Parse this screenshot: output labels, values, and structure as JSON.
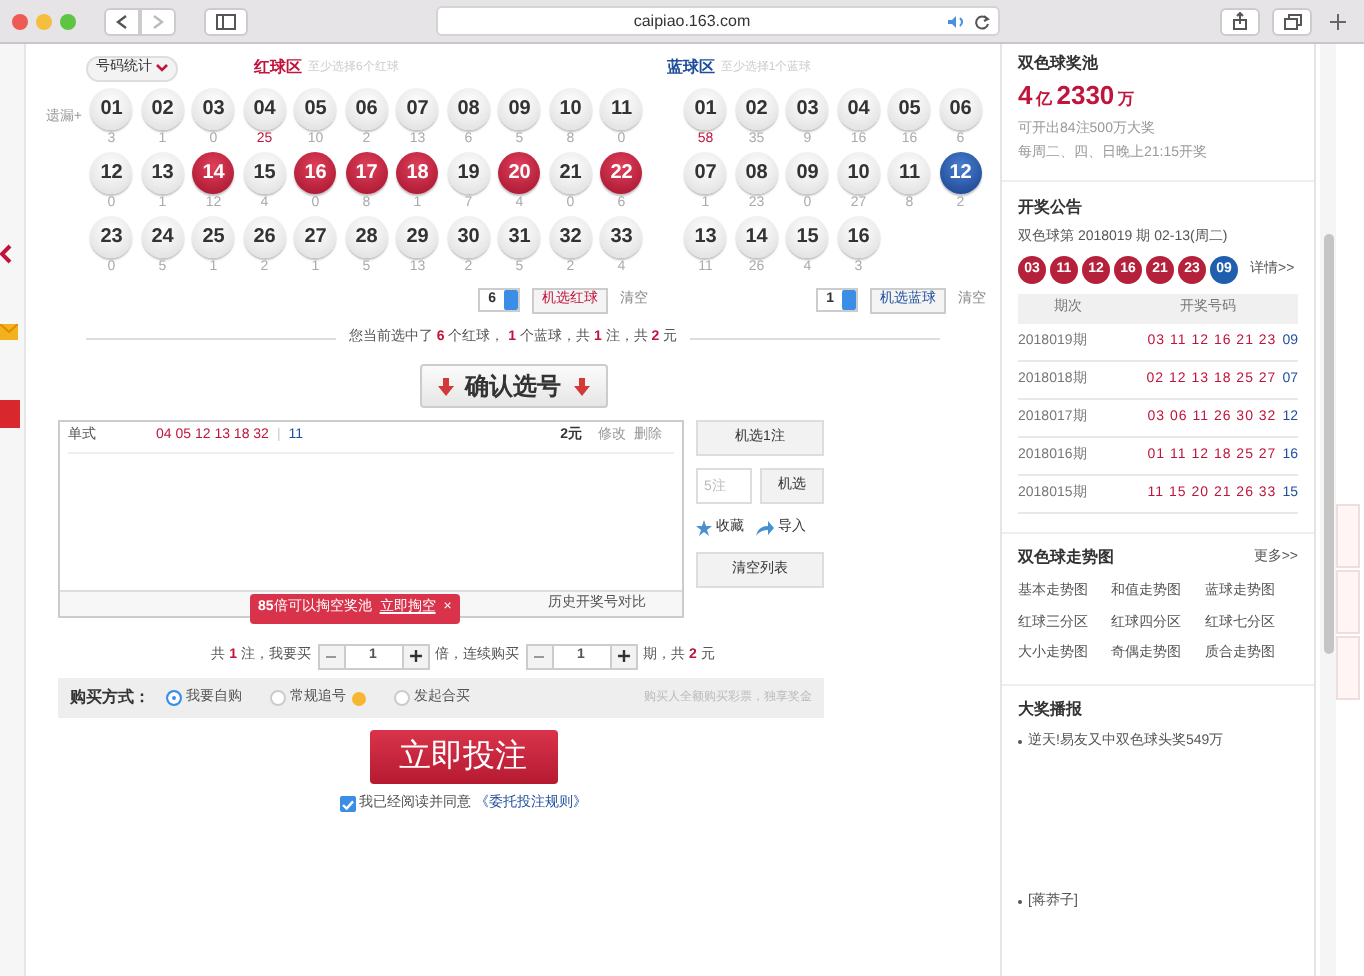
{
  "browser": {
    "url": "caipiao.163.com"
  },
  "stats_dropdown": "号码统计",
  "red_zone": {
    "title": "红球区",
    "hint": "至少选择6个红球",
    "miss_label": "遗漏+",
    "random_count": "6",
    "random_button": "机选红球",
    "clear": "清空",
    "balls": [
      {
        "number": "01",
        "miss": "3",
        "hot": false,
        "selected": false
      },
      {
        "number": "02",
        "miss": "1",
        "hot": false,
        "selected": false
      },
      {
        "number": "03",
        "miss": "0",
        "hot": false,
        "selected": false
      },
      {
        "number": "04",
        "miss": "25",
        "hot": true,
        "selected": false
      },
      {
        "number": "05",
        "miss": "10",
        "hot": false,
        "selected": false
      },
      {
        "number": "06",
        "miss": "2",
        "hot": false,
        "selected": false
      },
      {
        "number": "07",
        "miss": "13",
        "hot": false,
        "selected": false
      },
      {
        "number": "08",
        "miss": "6",
        "hot": false,
        "selected": false
      },
      {
        "number": "09",
        "miss": "5",
        "hot": false,
        "selected": false
      },
      {
        "number": "10",
        "miss": "8",
        "hot": false,
        "selected": false
      },
      {
        "number": "11",
        "miss": "0",
        "hot": false,
        "selected": false
      },
      {
        "number": "12",
        "miss": "0",
        "hot": false,
        "selected": false
      },
      {
        "number": "13",
        "miss": "1",
        "hot": false,
        "selected": false
      },
      {
        "number": "14",
        "miss": "12",
        "hot": false,
        "selected": true
      },
      {
        "number": "15",
        "miss": "4",
        "hot": false,
        "selected": false
      },
      {
        "number": "16",
        "miss": "0",
        "hot": false,
        "selected": true
      },
      {
        "number": "17",
        "miss": "8",
        "hot": false,
        "selected": true
      },
      {
        "number": "18",
        "miss": "1",
        "hot": false,
        "selected": true
      },
      {
        "number": "19",
        "miss": "7",
        "hot": false,
        "selected": false
      },
      {
        "number": "20",
        "miss": "4",
        "hot": false,
        "selected": true
      },
      {
        "number": "21",
        "miss": "0",
        "hot": false,
        "selected": false
      },
      {
        "number": "22",
        "miss": "6",
        "hot": false,
        "selected": true
      },
      {
        "number": "23",
        "miss": "0",
        "hot": false,
        "selected": false
      },
      {
        "number": "24",
        "miss": "5",
        "hot": false,
        "selected": false
      },
      {
        "number": "25",
        "miss": "1",
        "hot": false,
        "selected": false
      },
      {
        "number": "26",
        "miss": "2",
        "hot": false,
        "selected": false
      },
      {
        "number": "27",
        "miss": "1",
        "hot": false,
        "selected": false
      },
      {
        "number": "28",
        "miss": "5",
        "hot": false,
        "selected": false
      },
      {
        "number": "29",
        "miss": "13",
        "hot": false,
        "selected": false
      },
      {
        "number": "30",
        "miss": "2",
        "hot": false,
        "selected": false
      },
      {
        "number": "31",
        "miss": "5",
        "hot": false,
        "selected": false
      },
      {
        "number": "32",
        "miss": "2",
        "hot": false,
        "selected": false
      },
      {
        "number": "33",
        "miss": "4",
        "hot": false,
        "selected": false
      }
    ]
  },
  "blue_zone": {
    "title": "蓝球区",
    "hint": "至少选择1个蓝球",
    "random_count": "1",
    "random_button": "机选蓝球",
    "clear": "清空",
    "balls": [
      {
        "number": "01",
        "miss": "58",
        "hot": true,
        "selected": false
      },
      {
        "number": "02",
        "miss": "35",
        "hot": false,
        "selected": false
      },
      {
        "number": "03",
        "miss": "9",
        "hot": false,
        "selected": false
      },
      {
        "number": "04",
        "miss": "16",
        "hot": false,
        "selected": false
      },
      {
        "number": "05",
        "miss": "16",
        "hot": false,
        "selected": false
      },
      {
        "number": "06",
        "miss": "6",
        "hot": false,
        "selected": false
      },
      {
        "number": "07",
        "miss": "1",
        "hot": false,
        "selected": false
      },
      {
        "number": "08",
        "miss": "23",
        "hot": false,
        "selected": false
      },
      {
        "number": "09",
        "miss": "0",
        "hot": false,
        "selected": false
      },
      {
        "number": "10",
        "miss": "27",
        "hot": false,
        "selected": false
      },
      {
        "number": "11",
        "miss": "8",
        "hot": false,
        "selected": false
      },
      {
        "number": "12",
        "miss": "2",
        "hot": false,
        "selected": true
      },
      {
        "number": "13",
        "miss": "11",
        "hot": false,
        "selected": false
      },
      {
        "number": "14",
        "miss": "26",
        "hot": false,
        "selected": false
      },
      {
        "number": "15",
        "miss": "4",
        "hot": false,
        "selected": false
      },
      {
        "number": "16",
        "miss": "3",
        "hot": false,
        "selected": false
      }
    ]
  },
  "summary": "您当前选中了 **6** 个红球， **1** 个蓝球，共 **1** 注，共 **2** 元",
  "confirm_button": "确认选号",
  "ticket": {
    "type": "单式",
    "red": "04 05 12 13 18 32",
    "separator": "|",
    "blue": "11",
    "price": "2元",
    "edit": "修改",
    "delete": "删除"
  },
  "tooltip": {
    "text": "**85**倍可以掏空奖池",
    "link": "立即掏空",
    "close": "×"
  },
  "history_link": "历史开奖号对比",
  "side_buttons": {
    "random_one": "机选1注",
    "count_placeholder": "5注",
    "random": "机选",
    "favorite": "收藏",
    "import": "导入",
    "clear_list": "清空列表"
  },
  "quantity": {
    "lead": "共 **1** 注，我要买",
    "multiple": "1",
    "mid": "倍，连续购买",
    "periods": "1",
    "tail": "期，共 **2** 元"
  },
  "purchase": {
    "label": "购买方式：",
    "note": "购买人全额购买彩票，独享奖金",
    "options": [
      {
        "label": "我要自购",
        "selected": true,
        "help": false
      },
      {
        "label": "常规追号",
        "selected": false,
        "help": true
      },
      {
        "label": "发起合买",
        "selected": false,
        "help": false
      }
    ]
  },
  "bet_button": "立即投注",
  "agreement": {
    "checked": true,
    "text": "我已经阅读并同意",
    "link": "《委托投注规则》"
  },
  "sidebar": {
    "jackpot": {
      "title": "双色球奖池",
      "yi": "4",
      "yi_unit": "亿",
      "wan": "2330",
      "wan_unit": "万",
      "line1": "可开出84注500万大奖",
      "line2": "每周二、四、日晚上21:15开奖"
    },
    "draw": {
      "title": "开奖公告",
      "issue": "双色球第 2018019 期 02-13(周二)",
      "details": "详情>>",
      "columns": [
        "期次",
        "开奖号码"
      ],
      "balls": [
        {
          "number": "03",
          "kind": "red"
        },
        {
          "number": "11",
          "kind": "red"
        },
        {
          "number": "12",
          "kind": "red"
        },
        {
          "number": "16",
          "kind": "red"
        },
        {
          "number": "21",
          "kind": "red"
        },
        {
          "number": "23",
          "kind": "red"
        },
        {
          "number": "09",
          "kind": "blue"
        }
      ],
      "rows": [
        {
          "period": "2018019期",
          "red": "03 11 12 16 21 23",
          "blue": "09"
        },
        {
          "period": "2018018期",
          "red": "02 12 13 18 25 27",
          "blue": "07"
        },
        {
          "period": "2018017期",
          "red": "03 06 11 26 30 32",
          "blue": "12"
        },
        {
          "period": "2018016期",
          "red": "01 11 12 18 25 27",
          "blue": "16"
        },
        {
          "period": "2018015期",
          "red": "11 15 20 21 26 33",
          "blue": "15"
        }
      ]
    },
    "trends": {
      "title": "双色球走势图",
      "more": "更多>>",
      "links": [
        "基本走势图",
        "和值走势图",
        "蓝球走势图",
        "红球三分区",
        "红球四分区",
        "红球七分区",
        "大小走势图",
        "奇偶走势图",
        "质合走势图"
      ]
    },
    "news": {
      "title": "大奖播报",
      "items": [
        "逆天!易友又中双色球头奖549万",
        "[蒋莽子]"
      ]
    }
  }
}
